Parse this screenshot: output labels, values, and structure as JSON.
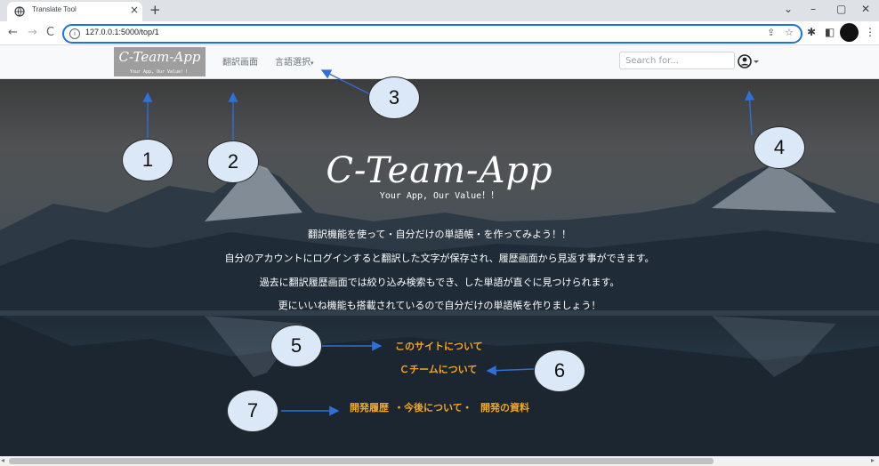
{
  "browser": {
    "tab_title": "Translate Tool",
    "tab_close": "×",
    "new_tab": "+",
    "url": "127.0.0.1:5000/top/1",
    "back": "←",
    "forward": "→",
    "reload": "C",
    "window_minimize": "–",
    "window_restore": "▢",
    "window_close": "✕",
    "tab_search": "⌄"
  },
  "navbar": {
    "brand_name": "C-Team-App",
    "brand_tagline": "Your App, Our Value！！",
    "link_translate": "翻訳画面",
    "link_language": "言語選択",
    "search_placeholder": "Search for..."
  },
  "hero": {
    "title": "C-Team-App",
    "tagline": "Your App, Our Value！！",
    "description": [
      "翻訳機能を使って・自分だけの単語帳・を作ってみよう！！",
      "自分のアカウントにログインすると翻訳した文字が保存され、履歴画面から見返す事ができます。",
      "過去に翻訳履歴画面では絞り込み検索もでき、した単語が直ぐに見つけられます。",
      "更にいいね機能も搭載されているので自分だけの単語帳を作りましょう！"
    ],
    "links": {
      "about_site": "このサイトについて",
      "about_team": "Ｃチームについて",
      "history": "開発履歴",
      "future": "・今後について・",
      "materials": "開発の資料"
    }
  },
  "annotations": {
    "badges": [
      "1",
      "2",
      "3",
      "4",
      "5",
      "6",
      "7"
    ]
  },
  "colors": {
    "link_orange": "#f5a623",
    "badge_fill": "#dbe8f7",
    "arrow_blue": "#2f6fd6",
    "omnibox_border": "#1a73e8"
  }
}
